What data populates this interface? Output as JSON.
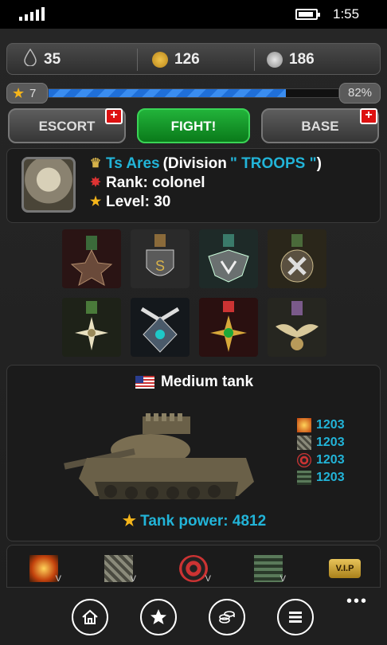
{
  "status": {
    "time": "1:55"
  },
  "resources": {
    "oil": "35",
    "coins": "126",
    "silver": "186"
  },
  "xp": {
    "level": "7",
    "percent_label": "82%",
    "progress": 0.82
  },
  "buttons": {
    "escort": "ESCORT",
    "fight": "FIGHT!",
    "base": "BASE",
    "plus": "+"
  },
  "profile": {
    "name": "Ts Ares",
    "division_prefix": "(Division",
    "division_name": "\" TROOPS \"",
    "division_suffix": ")",
    "rank": "Rank: colonel",
    "level": "Level: 30"
  },
  "medals": [
    "red-star-medal",
    "eagle-shield-medal",
    "winged-shield-medal",
    "cross-medal",
    "sunburst-medal",
    "teal-gem-medal",
    "gold-cross-medal",
    "winged-eagle-medal"
  ],
  "tank": {
    "title": "Medium tank",
    "stats": [
      {
        "icon": "explosion-icon",
        "value": "1203"
      },
      {
        "icon": "armor-icon",
        "value": "1203"
      },
      {
        "icon": "target-icon",
        "value": "1203"
      },
      {
        "icon": "speed-icon",
        "value": "1203"
      }
    ],
    "power": "Tank power: 4812"
  },
  "upgrades": [
    {
      "icon": "explosion-upgrade-icon",
      "badge": "V"
    },
    {
      "icon": "armor-upgrade-icon",
      "badge": "V"
    },
    {
      "icon": "target-upgrade-icon",
      "badge": "V"
    },
    {
      "icon": "speed-upgrade-icon",
      "badge": "V"
    },
    {
      "icon": "vip-icon",
      "badge": "V.I.P"
    }
  ],
  "appbar": {
    "more": "•••"
  },
  "colors": {
    "accent_cyan": "#22b4d8",
    "fight_green": "#1ea034",
    "xp_blue": "#2f7fe6",
    "gold": "#f5b51a"
  }
}
